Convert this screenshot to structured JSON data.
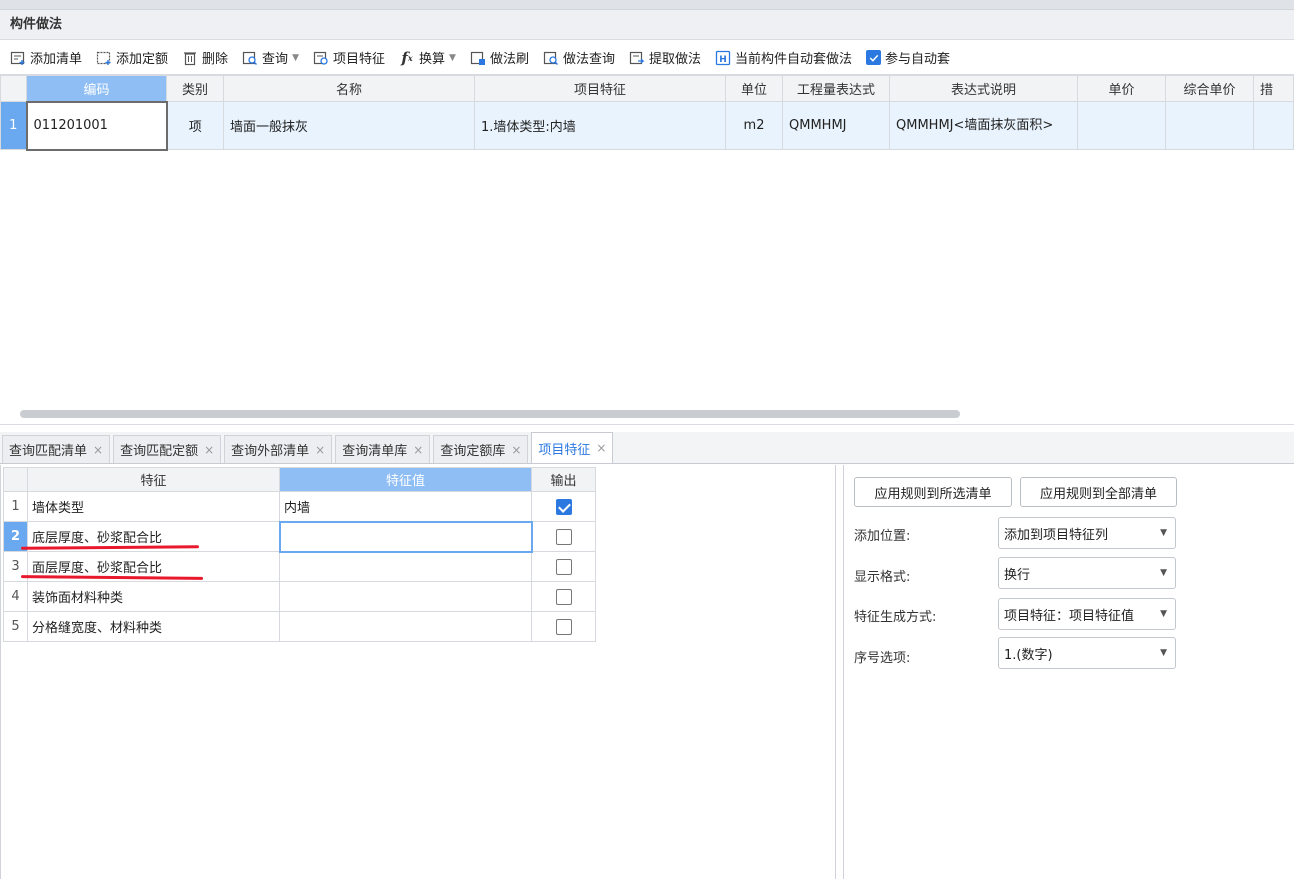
{
  "panel_title": "构件做法",
  "toolbar": {
    "add_list": "添加清单",
    "add_quota": "添加定额",
    "delete": "删除",
    "query": "查询",
    "item_feature": "项目特征",
    "convert": "换算",
    "method_brush": "做法刷",
    "method_query": "做法查询",
    "extract_method": "提取做法",
    "auto_apply_current": "当前构件自动套做法",
    "join_auto_apply": "参与自动套"
  },
  "top_grid": {
    "headers": [
      "编码",
      "类别",
      "名称",
      "项目特征",
      "单位",
      "工程量表达式",
      "表达式说明",
      "单价",
      "综合单价",
      "措"
    ],
    "rows": [
      {
        "no": "1",
        "code": "011201001",
        "type": "项",
        "name": "墙面一般抹灰",
        "feature": "1.墙体类型:内墙",
        "unit": "m2",
        "expr": "QMMHMJ",
        "expr_desc": "QMMHMJ<墙面抹灰面积>",
        "price": "",
        "total_price": ""
      }
    ]
  },
  "tabs": [
    {
      "label": "查询匹配清单",
      "active": false
    },
    {
      "label": "查询匹配定额",
      "active": false
    },
    {
      "label": "查询外部清单",
      "active": false
    },
    {
      "label": "查询清单库",
      "active": false
    },
    {
      "label": "查询定额库",
      "active": false
    },
    {
      "label": "项目特征",
      "active": true
    }
  ],
  "feature_grid": {
    "headers": [
      "特征",
      "特征值",
      "输出"
    ],
    "rows": [
      {
        "no": "1",
        "feature": "墙体类型",
        "value": "内墙",
        "output": true
      },
      {
        "no": "2",
        "feature": "底层厚度、砂浆配合比",
        "value": "",
        "output": false
      },
      {
        "no": "3",
        "feature": "面层厚度、砂浆配合比",
        "value": "",
        "output": false
      },
      {
        "no": "4",
        "feature": "装饰面材料种类",
        "value": "",
        "output": false
      },
      {
        "no": "5",
        "feature": "分格缝宽度、材料种类",
        "value": "",
        "output": false
      }
    ]
  },
  "right_panel": {
    "apply_selected": "应用规则到所选清单",
    "apply_all": "应用规则到全部清单",
    "add_position_label": "添加位置:",
    "add_position_value": "添加到项目特征列",
    "display_format_label": "显示格式:",
    "display_format_value": "换行",
    "gen_method_label": "特征生成方式:",
    "gen_method_value": "项目特征：项目特征值",
    "seq_label": "序号选项:",
    "seq_value": "1.(数字)"
  },
  "colors": {
    "accent": "#2b79e0",
    "selected_header": "#8fbef5",
    "row_number_selected": "#6aa9ef",
    "annotation_red": "#e8192c"
  }
}
